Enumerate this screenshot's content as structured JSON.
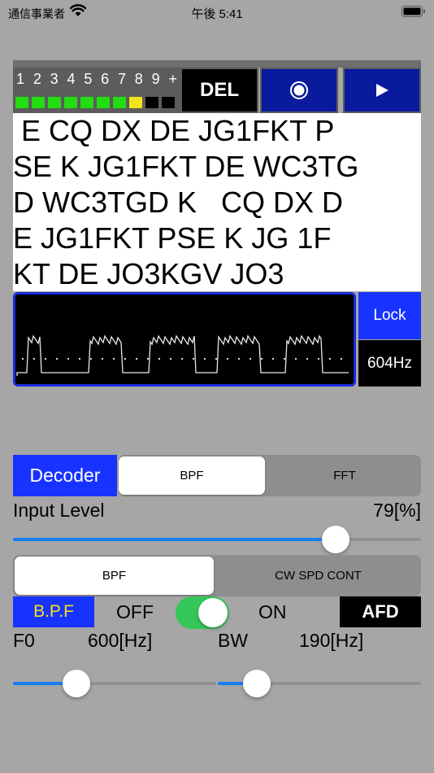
{
  "status_bar": {
    "carrier": "通信事業者",
    "time": "午後 5:41"
  },
  "level_meter": {
    "numbers": [
      "1",
      "2",
      "3",
      "4",
      "5",
      "6",
      "7",
      "8",
      "9",
      "+"
    ],
    "leds": [
      "#22dd11",
      "#22dd11",
      "#22dd11",
      "#22dd11",
      "#22dd11",
      "#22dd11",
      "#22dd11",
      "#f2e21a",
      "#000000",
      "#000000"
    ]
  },
  "toolbar": {
    "del_label": "DEL",
    "record_icon": "record-icon",
    "play_icon": "play-icon"
  },
  "decoded_text": {
    "lines": [
      " E CQ DX DE JG1FKT P",
      "SE K JG1FKT DE WC3TG",
      "D WC3TGD K   CQ DX D",
      "E JG1FKT PSE K JG 1F",
      "KT DE JO3KGV JO3"
    ]
  },
  "waveform": {
    "lock_label": "Lock",
    "frequency": "604Hz"
  },
  "decoder": {
    "label": "Decoder",
    "options": [
      "BPF",
      "FFT"
    ],
    "selected": "BPF"
  },
  "input_level": {
    "label": "Input Level",
    "value_text": "79[%]",
    "value": 0.79
  },
  "mode": {
    "options": [
      "BPF",
      "CW SPD CONT"
    ],
    "selected": "BPF"
  },
  "bpf": {
    "label": "B.P.F",
    "off_label": "OFF",
    "on_label": "ON",
    "enabled": true,
    "afd_label": "AFD"
  },
  "f0": {
    "label": "F0",
    "value_text": "600[Hz]",
    "value": 0.31
  },
  "bw": {
    "label": "BW",
    "value_text": "190[Hz]",
    "value": 0.19
  },
  "colors": {
    "accent_blue": "#1833ff",
    "dark_blue": "#0a1a9c",
    "slider_blue": "#1a7ef5",
    "toggle_green": "#35c759",
    "bpf_text_yellow": "#f5e11a"
  }
}
